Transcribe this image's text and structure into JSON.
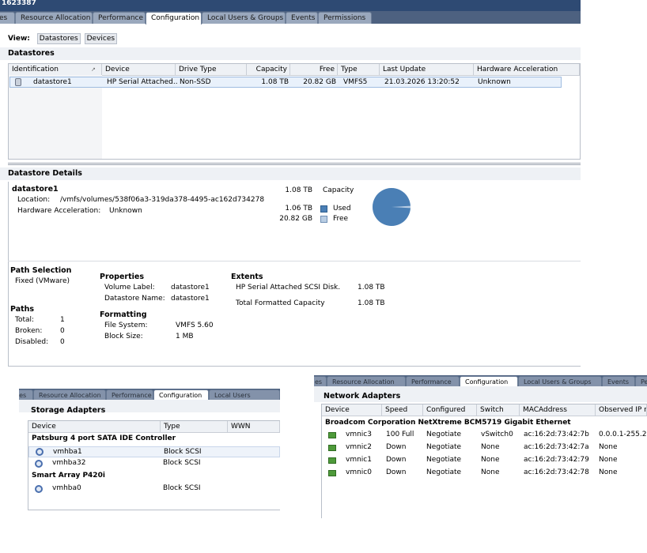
{
  "window": {
    "title_fragment": "1623387"
  },
  "tabs": [
    "es",
    "Resource Allocation",
    "Performance",
    "Configuration",
    "Local Users & Groups",
    "Events",
    "Permissions"
  ],
  "view": {
    "label": "View:",
    "datastores_btn": "Datastores",
    "devices_btn": "Devices"
  },
  "datastores": {
    "heading": "Datastores",
    "columns": [
      "Identification",
      "Device",
      "Drive Type",
      "Capacity",
      "Free",
      "Type",
      "Last Update",
      "Hardware Acceleration"
    ],
    "rows": [
      {
        "identification": "datastore1",
        "device": "HP Serial Attached...",
        "drive_type": "Non-SSD",
        "capacity": "1.08 TB",
        "free": "20.82 GB",
        "type": "VMFS5",
        "last_update": "21.03.2026 13:20:52",
        "hw_accel": "Unknown"
      }
    ]
  },
  "details": {
    "heading": "Datastore Details",
    "name": "datastore1",
    "location_label": "Location:",
    "location_value": "/vmfs/volumes/538f06a3-319da378-4495-ac162d734278",
    "hw_label": "Hardware Acceleration:",
    "hw_value": "Unknown",
    "capacity_value": "1.08 TB",
    "capacity_label": "Capacity",
    "used_value": "1.06 TB",
    "used_label": "Used",
    "free_value": "20.82 GB",
    "free_label": "Free",
    "used_color": "#4a7fb5",
    "free_color": "#b9cde3",
    "used_fraction": 0.9816
  },
  "path_selection": {
    "heading": "Path Selection",
    "value": "Fixed (VMware)"
  },
  "paths": {
    "heading": "Paths",
    "total_label": "Total:",
    "total": "1",
    "broken_label": "Broken:",
    "broken": "0",
    "disabled_label": "Disabled:",
    "disabled": "0"
  },
  "properties": {
    "heading": "Properties",
    "volume_label_label": "Volume Label:",
    "volume_label": "datastore1",
    "ds_name_label": "Datastore Name:",
    "ds_name": "datastore1"
  },
  "formatting": {
    "heading": "Formatting",
    "fs_label": "File System:",
    "fs": "VMFS 5.60",
    "bs_label": "Block Size:",
    "bs": "1 MB"
  },
  "extents": {
    "heading": "Extents",
    "disk_label": "HP Serial Attached SCSI Disk.",
    "disk_value": "1.08 TB",
    "total_label": "Total Formatted Capacity",
    "total_value": "1.08 TB"
  },
  "storage_adapters": {
    "bg_tabs": [
      "nes",
      "Resource Allocation",
      "Performance",
      "Configuration",
      "Local Users"
    ],
    "heading": "Storage Adapters",
    "columns": [
      "Device",
      "Type",
      "WWN"
    ],
    "group1": "Patsburg 4 port SATA IDE Controller",
    "g1_rows": [
      {
        "device": "vmhba1",
        "type": "Block SCSI"
      },
      {
        "device": "vmhba32",
        "type": "Block SCSI"
      }
    ],
    "group2": "Smart Array P420i",
    "g2_rows": [
      {
        "device": "vmhba0",
        "type": "Block SCSI"
      }
    ]
  },
  "network_adapters": {
    "bg_tabs": [
      "es",
      "Resource Allocation",
      "Performance",
      "Configuration",
      "Local Users & Groups",
      "Events",
      "Pe"
    ],
    "heading": "Network Adapters",
    "columns": [
      "Device",
      "Speed",
      "Configured",
      "Switch",
      "MACAddress",
      "Observed IP r"
    ],
    "group": "Broadcom Corporation NetXtreme BCM5719 Gigabit Ethernet",
    "rows": [
      {
        "device": "vmnic3",
        "speed": "100 Full",
        "configured": "Negotiate",
        "switch": "vSwitch0",
        "mac": "ac:16:2d:73:42:7b",
        "ip": "0.0.0.1-255.25"
      },
      {
        "device": "vmnic2",
        "speed": "Down",
        "configured": "Negotiate",
        "switch": "None",
        "mac": "ac:16:2d:73:42:7a",
        "ip": "None"
      },
      {
        "device": "vmnic1",
        "speed": "Down",
        "configured": "Negotiate",
        "switch": "None",
        "mac": "ac:16:2d:73:42:79",
        "ip": "None"
      },
      {
        "device": "vmnic0",
        "speed": "Down",
        "configured": "Negotiate",
        "switch": "None",
        "mac": "ac:16:2d:73:42:78",
        "ip": "None"
      }
    ]
  }
}
